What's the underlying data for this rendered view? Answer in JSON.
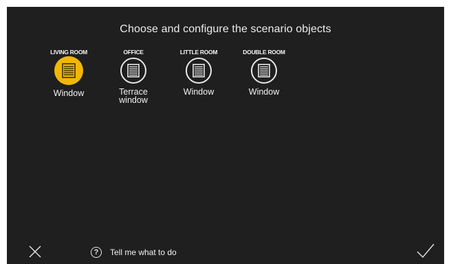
{
  "header": {
    "title": "Choose and configure the scenario objects"
  },
  "objects": [
    {
      "room": "LIVING ROOM",
      "label": "Window",
      "selected": true,
      "icon": "window-blind-icon"
    },
    {
      "room": "OFFICE",
      "label": "Terrace window",
      "selected": false,
      "icon": "window-blind-icon"
    },
    {
      "room": "LITTLE ROOM",
      "label": "Window",
      "selected": false,
      "icon": "window-blind-icon"
    },
    {
      "room": "DOUBLE ROOM",
      "label": "Window",
      "selected": false,
      "icon": "window-blind-icon"
    }
  ],
  "footer": {
    "cancel_icon": "close-icon",
    "help_icon": "question-circle-icon",
    "help_label": "Tell me what to do",
    "confirm_icon": "checkmark-icon"
  },
  "colors": {
    "background": "#1f1f1f",
    "accent": "#f2b705",
    "text": "#f2f2f2"
  }
}
